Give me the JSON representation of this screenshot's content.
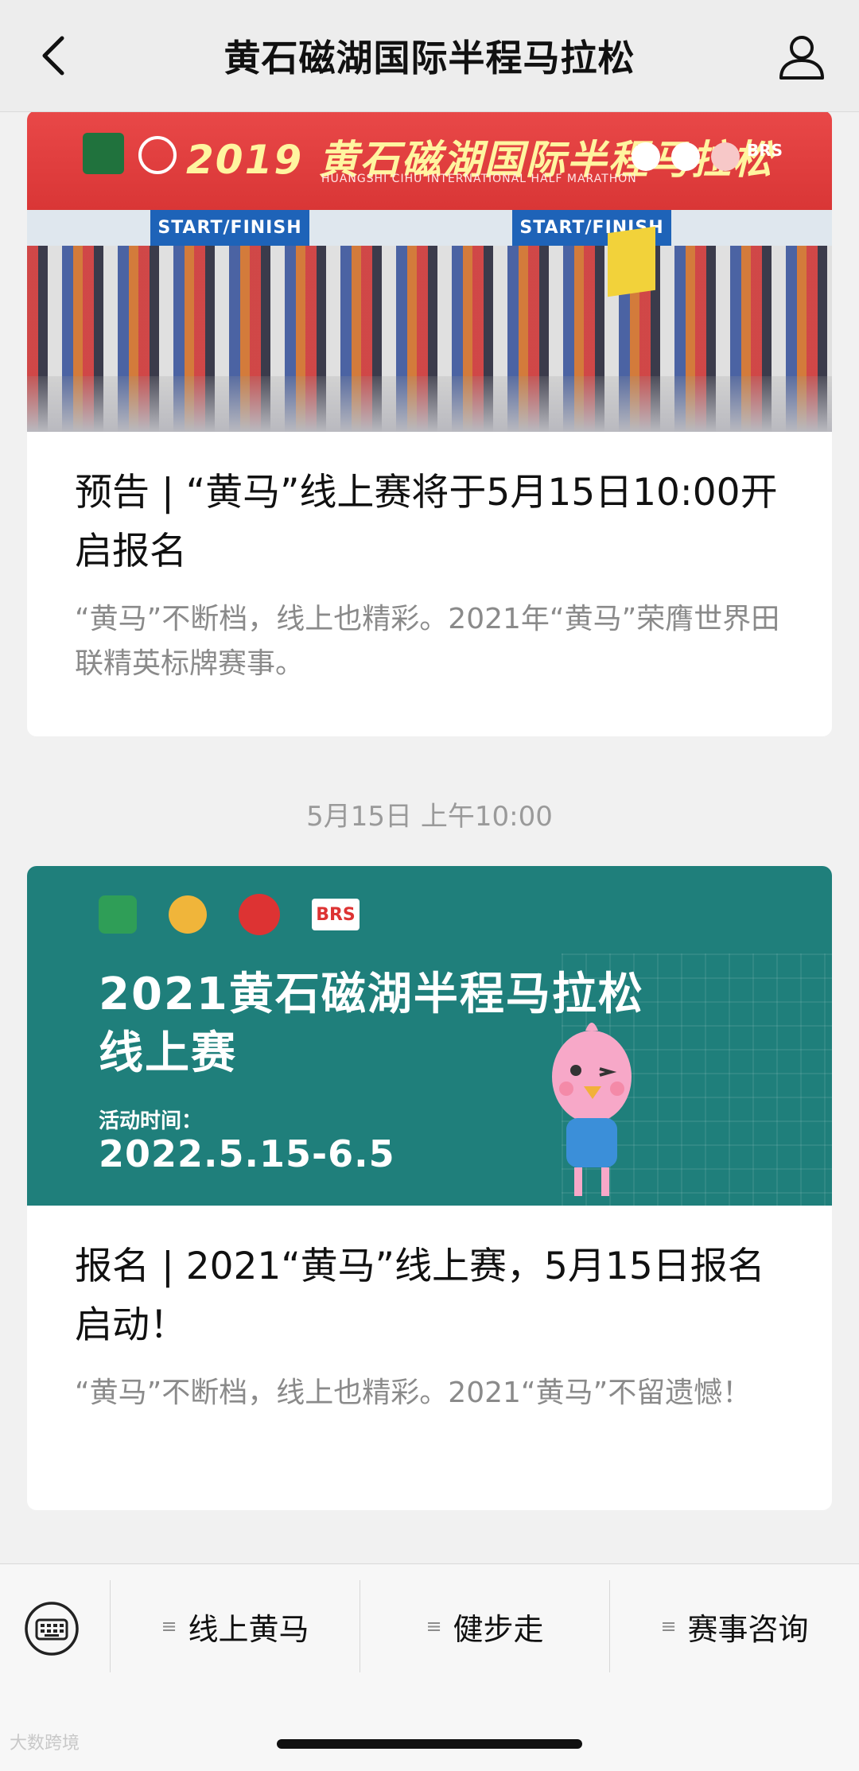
{
  "header": {
    "title": "黄石磁湖国际半程马拉松"
  },
  "articles": [
    {
      "banner": {
        "event_title": "2019 黄石磁湖国际半程马拉松",
        "event_subtitle": "HUANGSHI CIHU INTERNATIONAL HALF MARATHON",
        "arch_left": "START/FINISH",
        "arch_right": "START/FINISH",
        "sponsor": "BRS"
      },
      "title": "预告 | “黄马”线上赛将于5月15日10:00开启报名",
      "description": "“黄马”不断档，线上也精彩。2021年“黄马”荣膺世界田联精英标牌赛事。"
    },
    {
      "banner": {
        "logo_text": "BRS",
        "headline_line1": "2021黄石磁湖半程马拉松",
        "headline_line2": "线上赛",
        "time_label": "活动时间：",
        "time_value": "2022.5.15-6.5"
      },
      "title": "报名 | 2021“黄马”线上赛，5月15日报名启动！",
      "description": "“黄马”不断档，线上也精彩。2021“黄马”不留遗憾！"
    }
  ],
  "timestamp": "5月15日 上午10:00",
  "bottom_menu": {
    "items": [
      {
        "label": "线上黄马",
        "icon": "menu-lines-icon"
      },
      {
        "label": "健步走",
        "icon": "menu-lines-icon"
      },
      {
        "label": "赛事咨询",
        "icon": "menu-lines-icon"
      }
    ]
  },
  "watermark": "大数跨境"
}
